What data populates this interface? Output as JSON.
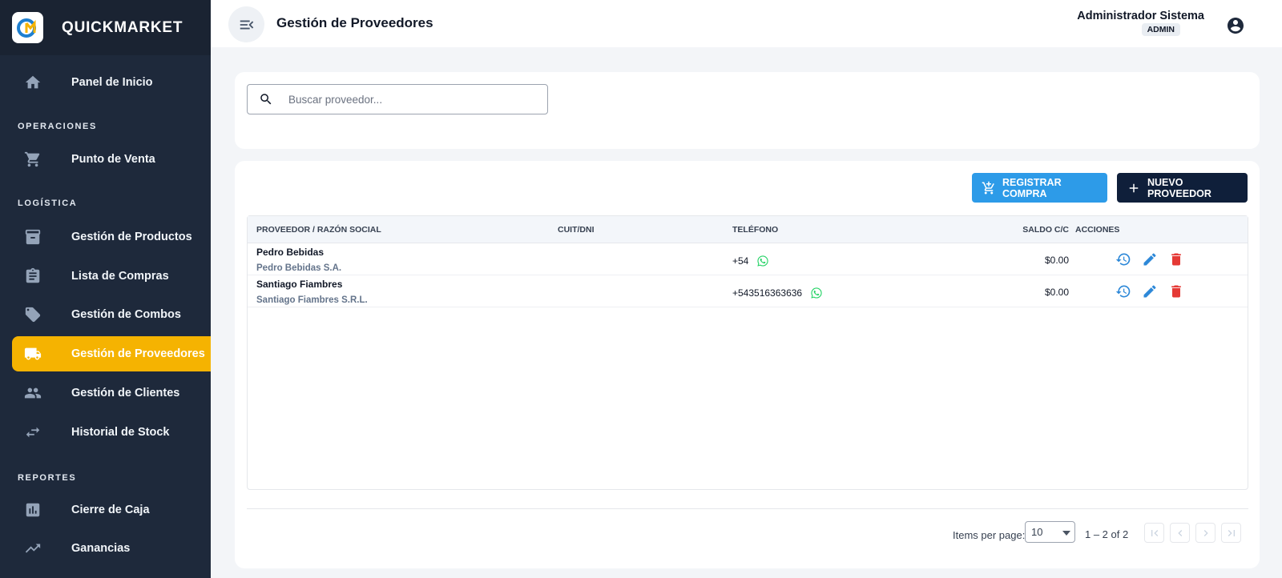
{
  "app": {
    "name": "QUICKMARKET"
  },
  "sidebar": {
    "sections": {
      "operaciones": "OPERACIONES",
      "logistica": "LOGÍSTICA",
      "reportes": "REPORTES"
    },
    "items": [
      {
        "label": "Panel de Inicio",
        "icon": "home-icon"
      },
      {
        "label": "Punto de Venta",
        "icon": "cart-icon"
      },
      {
        "label": "Gestión de Productos",
        "icon": "archive-icon"
      },
      {
        "label": "Lista de Compras",
        "icon": "clipboard-icon"
      },
      {
        "label": "Gestión de Combos",
        "icon": "tag-icon"
      },
      {
        "label": "Gestión de Proveedores",
        "icon": "truck-icon",
        "active": true
      },
      {
        "label": "Gestión de Clientes",
        "icon": "people-icon"
      },
      {
        "label": "Historial de Stock",
        "icon": "swap-icon"
      },
      {
        "label": "Cierre de Caja",
        "icon": "bar-chart-icon"
      },
      {
        "label": "Ganancias",
        "icon": "trending-up-icon"
      }
    ],
    "active_color": "#f5b301"
  },
  "header": {
    "title": "Gestión de Proveedores",
    "user_name": "Administrador Sistema",
    "role": "ADMIN"
  },
  "search": {
    "placeholder": "Buscar proveedor...",
    "value": ""
  },
  "toolbar": {
    "buy_label": "REGISTRAR COMPRA",
    "new_label": "NUEVO PROVEEDOR"
  },
  "table": {
    "columns": {
      "proveedor": "PROVEEDOR / RAZÓN SOCIAL",
      "cuit": "CUIT/DNI",
      "telefono": "TELÉFONO",
      "saldo": "SALDO C/C",
      "acciones": "ACCIONES"
    },
    "rows": [
      {
        "name": "Pedro Bebidas",
        "razon_social": "Pedro Bebidas S.A.",
        "cuit": "",
        "phone": "+54",
        "saldo": "$0.00"
      },
      {
        "name": "Santiago Fiambres",
        "razon_social": "Santiago Fiambres S.R.L.",
        "cuit": "",
        "phone": "+543516363636",
        "saldo": "$0.00"
      }
    ]
  },
  "paginator": {
    "items_per_page_label": "Items per page:",
    "items_per_page": "10",
    "range": "1 – 2 of 2"
  }
}
